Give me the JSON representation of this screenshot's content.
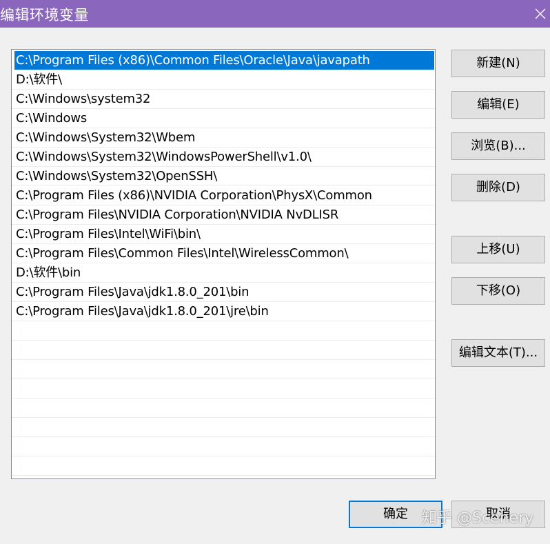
{
  "window": {
    "title": "编辑环境变量",
    "close_icon": "close-icon"
  },
  "path_list": {
    "selected_index": 0,
    "items": [
      "C:\\Program Files (x86)\\Common Files\\Oracle\\Java\\javapath",
      "D:\\软件\\",
      "C:\\Windows\\system32",
      "C:\\Windows",
      "C:\\Windows\\System32\\Wbem",
      "C:\\Windows\\System32\\WindowsPowerShell\\v1.0\\",
      "C:\\Windows\\System32\\OpenSSH\\",
      "C:\\Program Files (x86)\\NVIDIA Corporation\\PhysX\\Common",
      "C:\\Program Files\\NVIDIA Corporation\\NVIDIA NvDLISR",
      "C:\\Program Files\\Intel\\WiFi\\bin\\",
      "C:\\Program Files\\Common Files\\Intel\\WirelessCommon\\",
      "D:\\软件\\bin",
      "C:\\Program Files\\Java\\jdk1.8.0_201\\bin",
      "C:\\Program Files\\Java\\jdk1.8.0_201\\jre\\bin"
    ],
    "empty_rows": 8
  },
  "buttons": {
    "new": "新建(N)",
    "edit": "编辑(E)",
    "browse": "浏览(B)...",
    "delete": "删除(D)",
    "move_up": "上移(U)",
    "move_down": "下移(O)",
    "edit_text": "编辑文本(T)...",
    "ok": "确定",
    "cancel": "取消"
  },
  "watermark": "知乎 @Scenery",
  "colors": {
    "titlebar": "#8a66bd",
    "selection": "#0078d7",
    "dialog_bg": "#f0f0f0"
  }
}
